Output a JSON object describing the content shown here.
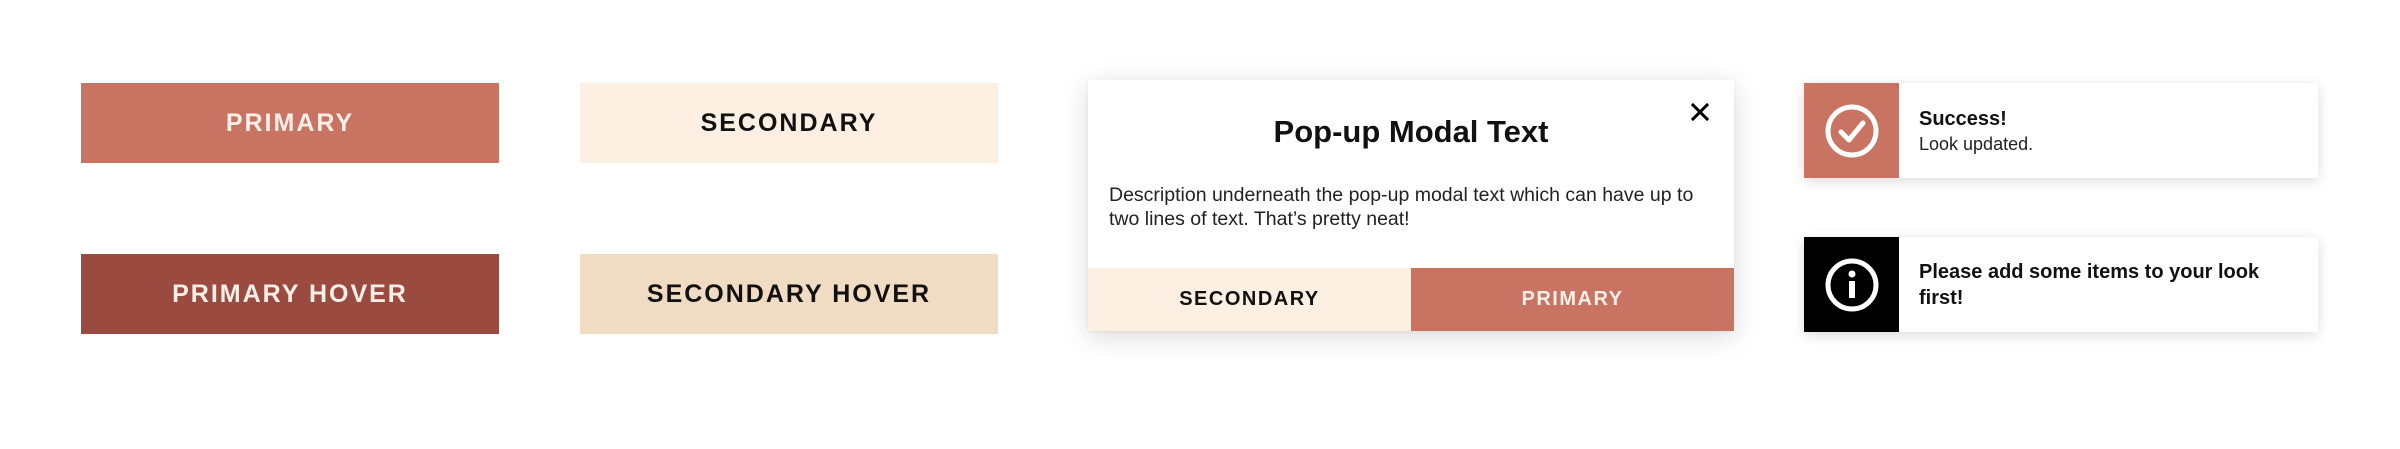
{
  "buttons": {
    "primary_label": "PRIMARY",
    "secondary_label": "SECONDARY",
    "primary_hover_label": "PRIMARY HOVER",
    "secondary_hover_label": "SECONDARY HOVER"
  },
  "modal": {
    "title": "Pop-up Modal Text",
    "description": "Description underneath the pop-up modal text which can have up to two lines of text. That’s pretty neat!",
    "close_icon": "close-icon",
    "secondary_label": "SECONDARY",
    "primary_label": "PRIMARY"
  },
  "toasts": {
    "success": {
      "icon": "check-circle-icon",
      "title": "Success!",
      "message": "Look updated."
    },
    "info": {
      "icon": "info-circle-icon",
      "title": "Please add some items to your look first!"
    }
  },
  "colors": {
    "primary": "#c97462",
    "primary_hover": "#9a4a3f",
    "secondary": "#fdefe2",
    "secondary_hover": "#f0dcc2",
    "info_icon_bg": "#000000"
  }
}
